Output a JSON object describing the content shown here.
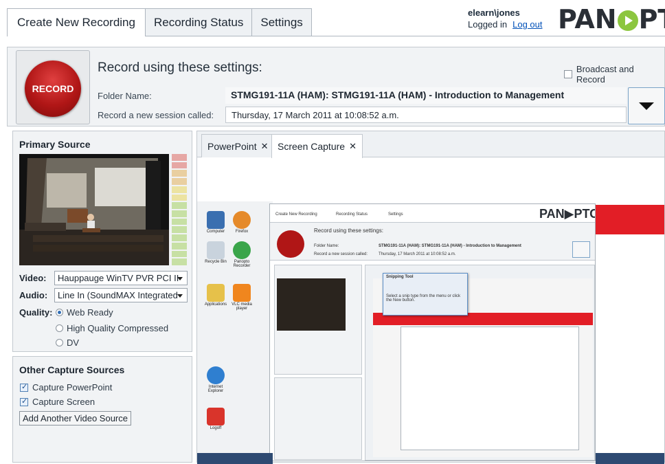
{
  "tabs": [
    "Create New Recording",
    "Recording Status",
    "Settings"
  ],
  "user": {
    "name": "elearn\\jones",
    "status": "Logged in",
    "logout": "Log out"
  },
  "logo": {
    "text_before": "PAN",
    "text_after": "PTO"
  },
  "record": {
    "button_label": "RECORD",
    "heading": "Record using these settings:",
    "broadcast_label": "Broadcast and Record",
    "folder_label": "Folder Name:",
    "folder_value": "STMG191-11A (HAM): STMG191-11A (HAM) - Introduction to Management",
    "session_label": "Record a new session called:",
    "session_value": "Thursday, 17 March 2011 at 10:08:52 a.m."
  },
  "primary": {
    "title": "Primary Source",
    "video_label": "Video:",
    "video_value": "Hauppauge WinTV PVR PCI II",
    "audio_label": "Audio:",
    "audio_value": "Line In (SoundMAX Integrated",
    "quality_label": "Quality:",
    "quality_options": [
      "Web Ready",
      "High Quality Compressed",
      "DV"
    ],
    "quality_selected": "Web Ready"
  },
  "other": {
    "title": "Other Capture Sources",
    "capture_powerpoint": "Capture PowerPoint",
    "capture_screen": "Capture Screen",
    "add_source": "Add Another Video Source"
  },
  "content_tabs": [
    "PowerPoint",
    "Screen Capture"
  ],
  "capture_preview": {
    "desktop_icons": [
      "Computer",
      "Recycle Bin",
      "Applications",
      "Firefox",
      "Panopto Recorder",
      "VLC media player",
      "Internet Explorer",
      "Logoff"
    ],
    "window_tabs": [
      "Create New Recording",
      "Recording Status",
      "Settings"
    ],
    "window_heading": "Record using these settings:",
    "window_folder_label": "Folder Name:",
    "window_folder_value": "STMG191-11A (HAM): STMG191-11A (HAM) - Introduction to Management",
    "window_session_label": "Record a new session called:",
    "window_session_value": "Thursday, 17 March 2011 at 10:08:52 a.m.",
    "snipping_title": "Snipping Tool",
    "snipping_text": "Select a snip type from the menu or click the New button."
  },
  "colors": {
    "record_red": "#b01616",
    "accent_blue": "#2f6db5",
    "panel_bg": "#f1f3f5",
    "logo_green": "#8cc63f"
  }
}
